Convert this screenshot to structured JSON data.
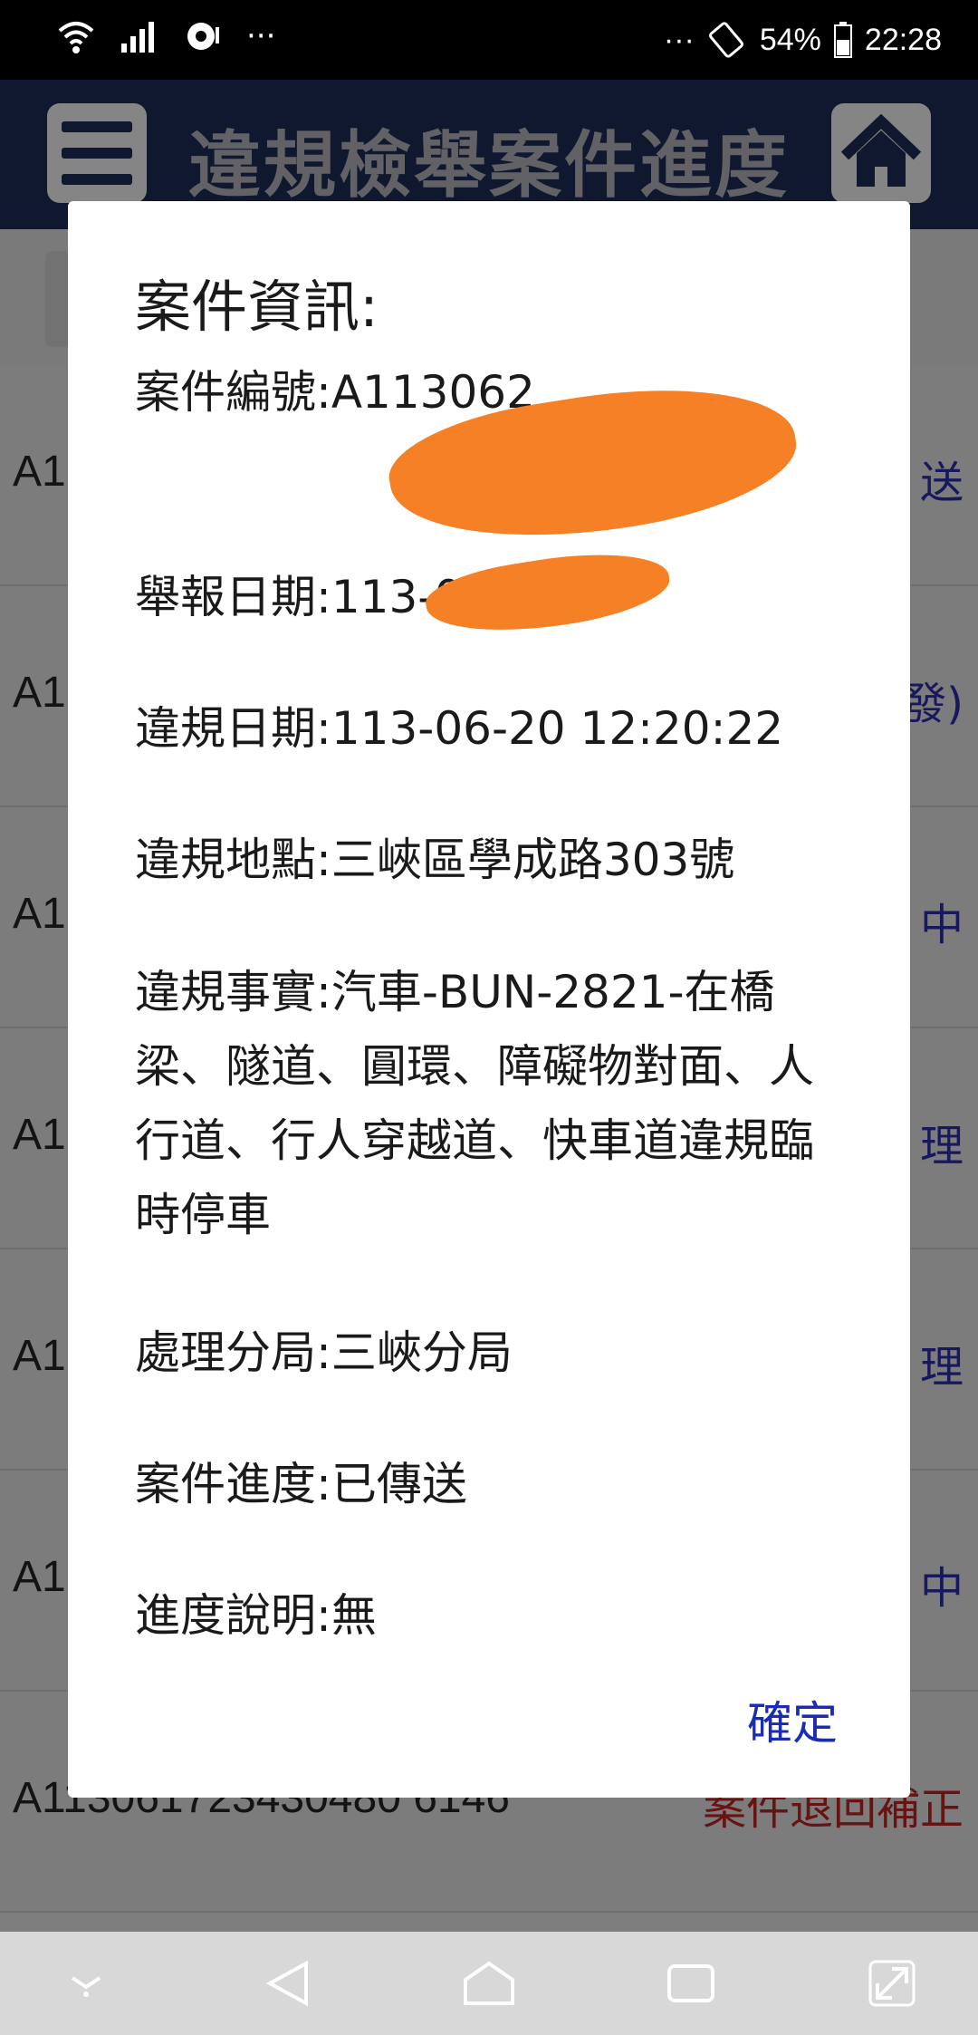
{
  "status_bar": {
    "dots": "···",
    "right_dots": "···",
    "battery": "54%",
    "time": "22:28"
  },
  "header": {
    "title": "違規檢舉案件進度"
  },
  "list": {
    "rows": [
      {
        "code": "A1",
        "status": "送"
      },
      {
        "code": "A1",
        "status": "發)"
      },
      {
        "code": "A1",
        "status": "中"
      },
      {
        "code": "A1",
        "status": "理"
      },
      {
        "code": "A1",
        "status": "理"
      },
      {
        "code": "A1",
        "status": "中"
      },
      {
        "code": "A113061723430480 6146",
        "status": "案件退回補正"
      }
    ]
  },
  "dialog": {
    "title": "案件資訊:",
    "case_no": "案件編號:A113062",
    "report_date": "舉報日期:113-06-20",
    "violation_date": "違規日期:113-06-20 12:20:22",
    "violation_place": "違規地點:三峽區學成路303號",
    "violation_fact": "違規事實:汽車-BUN-2821-在橋梁、隧道、圓環、障礙物對面、人行道、行人穿越道、快車道違規臨時停車",
    "handling_unit": "處理分局:三峽分局",
    "progress": "案件進度:已傳送",
    "progress_note": "進度說明:無",
    "confirm": "確定"
  },
  "colors": {
    "header_bg": "#1c2a52",
    "link_blue": "#1a2bb5",
    "redaction": "#f58026",
    "returned_red": "#b32020"
  }
}
